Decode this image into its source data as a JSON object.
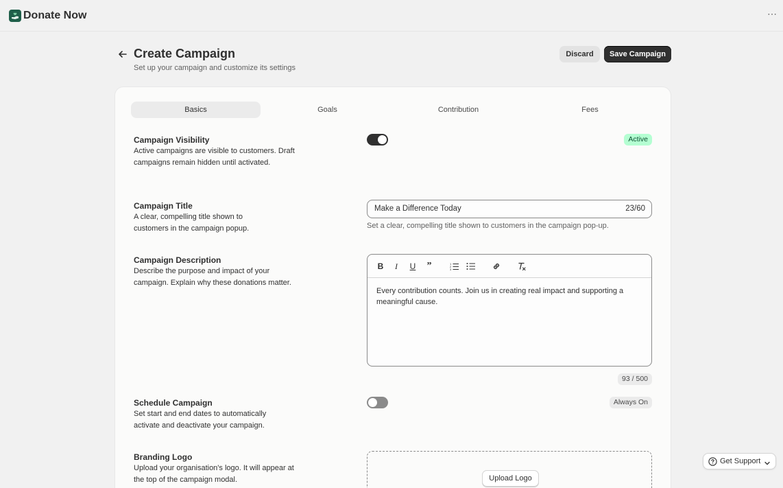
{
  "app": {
    "title": "Donate Now",
    "more_icon": "ellipsis-icon",
    "logo_icon": "hand-heart-icon"
  },
  "header": {
    "title": "Create Campaign",
    "subtitle": "Set up your campaign and customize its settings",
    "discard_label": "Discard",
    "save_label": "Save Campaign"
  },
  "tabs": [
    {
      "label": "Basics",
      "active": true
    },
    {
      "label": "Goals",
      "active": false
    },
    {
      "label": "Contribution",
      "active": false
    },
    {
      "label": "Fees",
      "active": false
    }
  ],
  "sections": {
    "visibility": {
      "title": "Campaign Visibility",
      "description": "Active campaigns are visible to customers. Draft campaigns remain hidden until activated.",
      "toggle_on": true,
      "badge": "Active"
    },
    "title": {
      "title": "Campaign Title",
      "description": "A clear, compelling title shown to customers in the campaign popup.",
      "value": "Make a Difference Today",
      "count": "23/60",
      "help": "Set a clear, compelling title shown to customers in the campaign pop-up."
    },
    "description": {
      "title": "Campaign Description",
      "description": "Describe the purpose and impact of your campaign. Explain why these donations matter.",
      "toolbar": [
        "bold-icon",
        "italic-icon",
        "underline-icon",
        "quote-icon",
        "ordered-list-icon",
        "bullet-list-icon",
        "link-icon",
        "clear-format-icon"
      ],
      "value": "Every contribution counts. Join us in creating real impact and supporting a meaningful cause.",
      "count": "93 / 500"
    },
    "schedule": {
      "title": "Schedule Campaign",
      "description": "Set start and end dates to automatically activate and deactivate your campaign.",
      "toggle_on": false,
      "badge": "Always On"
    },
    "logo": {
      "title": "Branding Logo",
      "description": "Upload your organisation's logo. It will appear at the top of the campaign modal.",
      "upload_label": "Upload Logo"
    }
  },
  "support": {
    "label": "Get Support"
  },
  "colors": {
    "accent": "#303030",
    "success_badge": "#b4fed2",
    "brand": "#1f5f4a"
  }
}
